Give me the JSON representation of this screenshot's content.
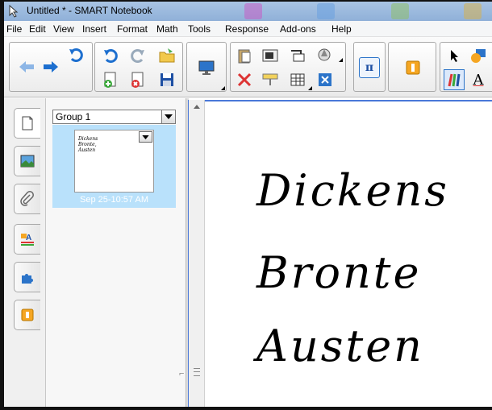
{
  "window": {
    "title": "Untitled * - SMART Notebook"
  },
  "menu": {
    "items": [
      "File",
      "Edit",
      "View",
      "Insert",
      "Format",
      "Math",
      "Tools",
      "Response",
      "Add-ons",
      "Help"
    ]
  },
  "toolbar": {
    "buttons": [
      "back-arrow-icon",
      "forward-arrow-icon",
      "undo-icon",
      "redo-icon",
      "open-file-icon",
      "new-page-icon",
      "delete-page-icon",
      "save-icon",
      "display-screen-icon",
      "paste-icon",
      "screen-shade-icon",
      "insert-icon",
      "capture-icon",
      "delete-icon",
      "screen-shade-2-icon",
      "table-icon",
      "fit-icon",
      "math-pi-icon",
      "addon-icon",
      "select-arrow-icon",
      "pens-icon",
      "shapes-icon",
      "text-icon"
    ],
    "pi_label": "π",
    "text_label": "A"
  },
  "sidebar": {
    "tabs": [
      "page-sorter-tab",
      "gallery-tab",
      "attachments-tab",
      "properties-tab",
      "addons-tab",
      "response-tab"
    ]
  },
  "sorter": {
    "group_label": "Group 1",
    "thumb_lines": [
      "Dickens",
      "Bronte,",
      "Austen"
    ],
    "thumb_date": "Sep 25-10:57 AM"
  },
  "page": {
    "ink_lines": [
      "Dickens",
      "Bronte",
      "Austen"
    ]
  },
  "colors": {
    "titlebar": "#a9c4e4",
    "selection": "#b9e1fb",
    "canvas_border": "#4a78d9"
  }
}
